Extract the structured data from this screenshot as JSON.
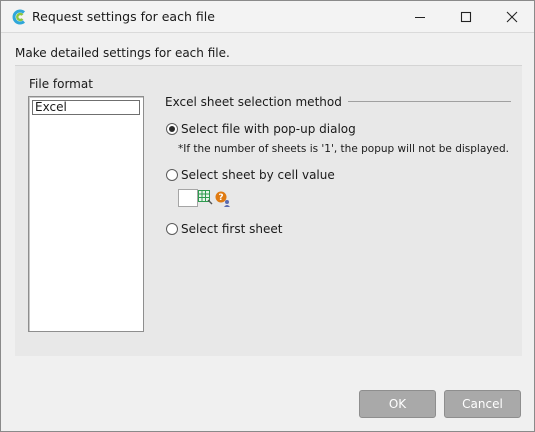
{
  "window": {
    "title": "Request settings for each file",
    "icon": "app-logo-icon"
  },
  "description": "Make detailed settings for each file.",
  "file_format": {
    "label": "File format",
    "items": [
      "Excel"
    ],
    "selected": "Excel"
  },
  "sheet_selection": {
    "group_title": "Excel sheet selection method",
    "options": [
      {
        "label": "Select file with pop-up dialog",
        "checked": true
      },
      {
        "label": "Select sheet by cell value",
        "checked": false
      },
      {
        "label": "Select first sheet",
        "checked": false
      }
    ],
    "note": "*If the number of sheets is '1', the popup will not be displayed.",
    "cell_value_input": "",
    "cell_picker_icon": "spreadsheet-grid-icon",
    "help_icon": "question-user-icon"
  },
  "buttons": {
    "ok": "OK",
    "cancel": "Cancel"
  },
  "colors": {
    "button_disabled_bg": "#a9a9a9",
    "panel_bg": "#e8e8e8",
    "window_bg": "#f0f0f0",
    "icon_green": "#2e9b4f",
    "icon_orange": "#e07b12"
  }
}
